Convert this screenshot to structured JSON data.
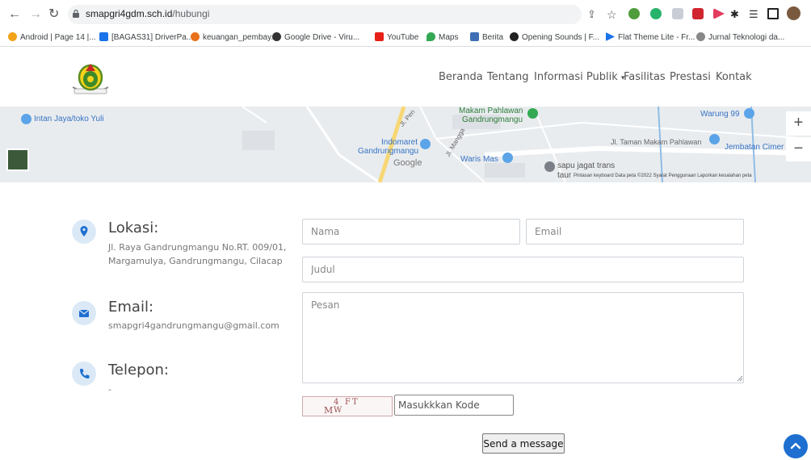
{
  "browser": {
    "url_host": "smapgri4gdm.sch.id",
    "url_path": "/hubungi",
    "bookmarks": [
      "Android | Page 14 |...",
      "[BAGAS31] DriverPa...",
      "keuangan_pembay...",
      "Google Drive - Viru...",
      "YouTube",
      "Maps",
      "Berita",
      "Opening Sounds | F...",
      "Flat Theme Lite - Fr...",
      "Jurnal Teknologi da..."
    ]
  },
  "nav": {
    "items": [
      "Beranda",
      "Tentang",
      "Informasi Publik",
      "Fasilitas",
      "Prestasi",
      "Kontak"
    ]
  },
  "map": {
    "labels": {
      "intan": "Intan Jaya/toko Yuli",
      "jl_pen": "Jl. Pen",
      "makam1": "Makam Pahlawan",
      "makam2": "Gandrungmangu",
      "warung": "Warung 99",
      "indomaret1": "Indomaret",
      "indomaret2": "Gandrungmangu",
      "google": "Google",
      "jl_mangga": "Jl. Mangga",
      "waris": "Waris Mas",
      "taman": "Jl. Taman Makam Pahlawan",
      "jembatan": "Jembatan Cimer",
      "sapu1": "sapu jagat trans",
      "sapu2": "taur",
      "footer": "Pintasan keyboard   Data peta ©2022   Syarat Penggunaan   Laporkan kesalahan peta"
    },
    "zoom_in": "+",
    "zoom_out": "−"
  },
  "contact": {
    "location_title": "Lokasi:",
    "location_line1": "Jl. Raya Gandrungmangu No.RT. 009/01,",
    "location_line2": "Margamulya, Gandrungmangu, Cilacap",
    "email_title": "Email:",
    "email_value": "smapgri4gandrungmangu@gmail.com",
    "phone_title": "Telepon:",
    "phone_value": "-"
  },
  "form": {
    "name_placeholder": "Nama",
    "email_placeholder": "Email",
    "subject_placeholder": "Judul",
    "message_placeholder": "Pesan",
    "captcha_chars": [
      "M",
      "4",
      "W",
      "F",
      "T"
    ],
    "code_placeholder": "Masukkkan Kode",
    "send_label": "Send a message"
  },
  "colors": {
    "accent": "#1e6fd0",
    "icon_bg": "#dbe9f7",
    "map_bg": "#e9ecef"
  }
}
